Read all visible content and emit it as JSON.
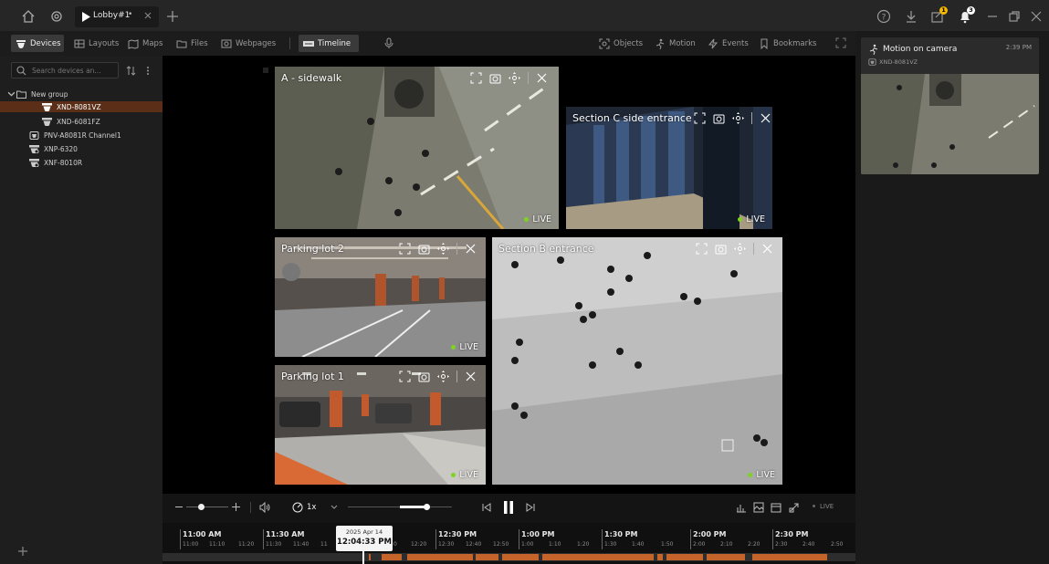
{
  "titlebar": {
    "tab_label": "Lobby#1",
    "tab_modified_marker": "•",
    "notification_count": "1",
    "alert_count": "3"
  },
  "toolbar": {
    "devices": "Devices",
    "layouts": "Layouts",
    "maps": "Maps",
    "files": "Files",
    "webpages": "Webpages",
    "timeline": "Timeline",
    "objects": "Objects",
    "motion": "Motion",
    "events": "Events",
    "bookmarks": "Bookmarks"
  },
  "sidebar": {
    "search_placeholder": "Search devices an...",
    "group": "New group",
    "items": [
      {
        "label": "XND-8081VZ",
        "selected": true
      },
      {
        "label": "XND-6081FZ",
        "selected": false
      },
      {
        "label": "PNV-A8081R Channel1",
        "selected": false
      },
      {
        "label": "XNP-6320",
        "selected": false
      },
      {
        "label": "XNF-8010R",
        "selected": false
      }
    ]
  },
  "tiles": {
    "a_sidewalk": {
      "title": "A - sidewalk",
      "live": "LIVE"
    },
    "section_c": {
      "title": "Section C side entrance",
      "live": "LIVE"
    },
    "parking2": {
      "title": "Parking lot 2",
      "live": "LIVE"
    },
    "section_b": {
      "title": "Section B entrance",
      "live": "LIVE"
    },
    "parking1": {
      "title": "Parking lot 1",
      "live": "LIVE"
    }
  },
  "notification": {
    "title": "Motion on camera",
    "time": "2:39 PM",
    "device": "XND-8081VZ"
  },
  "playback": {
    "speed": "1x",
    "live_label": "LIVE",
    "volume_level": 0.35,
    "seek_level": 0.75
  },
  "timeline": {
    "tooltip_date": "2025 Apr 14",
    "tooltip_time": "12:04:33 PM",
    "hours": [
      "11:00 AM",
      "11:30 AM",
      "12:30 PM",
      "1:00 PM",
      "1:30 PM",
      "2:00 PM",
      "2:30 PM"
    ],
    "minutes": [
      "11:00",
      "11:10",
      "11:20",
      "11:30",
      "11:40",
      "11",
      "0",
      "12:20",
      "12:30",
      "12:40",
      "12:50",
      "1:00",
      "1:10",
      "1:20",
      "1:30",
      "1:40",
      "1:50",
      "2:00",
      "2:10",
      "2:20",
      "2:30",
      "2:40",
      "2:50"
    ]
  },
  "colors": {
    "accent": "#e07a2a",
    "live_dot": "#7ed321",
    "record": "#c4642a",
    "selected_row": "#5a2e17"
  }
}
